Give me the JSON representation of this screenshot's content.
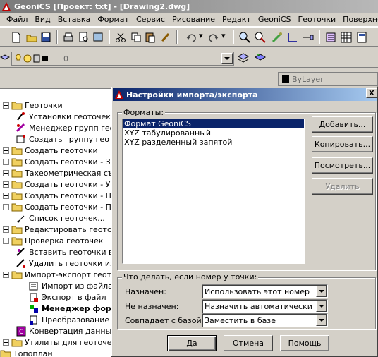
{
  "window": {
    "title": "GeoniCS [Проект: txt] - [Drawing2.dwg]"
  },
  "menubar": {
    "items": [
      "Файл",
      "Вид",
      "Вставка",
      "Формат",
      "Сервис",
      "Рисование",
      "Редакт",
      "GeoniCS",
      "Геоточки",
      "Поверхности"
    ]
  },
  "layer_toolbar": {
    "layer_value": "0",
    "color_value": "ByLayer"
  },
  "tree": {
    "items": [
      "Геоточки",
      "Установки геоточек",
      "Менеджер групп геоточек",
      "Создать группу геоточек",
      "Создать геоточки",
      "Создать геоточки - За",
      "Тахеометрическая съ",
      "Создать геоточки - Ук",
      "Создать геоточки - Пр",
      "Создать геоточки - По",
      "Список геоточек...",
      "Редактировать геоточ",
      "Проверка геоточек",
      "Вставить геоточки в ч",
      "Удалить геоточки из ч",
      "Импорт-экспорт геоточ",
      "Импорт из файла",
      "Экспорт в файл",
      "Менеджер форм",
      "Преобразование",
      "Конвертация данных",
      "Утилиты для геоточек",
      "Топоплан"
    ]
  },
  "dialog": {
    "title": "Настройки импорта/экспорта",
    "close_label": "X",
    "formats_label": "Форматы:",
    "formats": [
      "Формат GeoniCS",
      "XYZ табулированный",
      "XYZ разделенный запятой"
    ],
    "selected_format_index": 0,
    "buttons": {
      "add": "Добавить...",
      "copy": "Копировать...",
      "view": "Посмотреть...",
      "delete": "Удалить"
    },
    "point_number_group": {
      "label": "Что делать, если номер у точки:",
      "assigned_label": "Назначен:",
      "assigned_value": "Использовать этот номер",
      "not_assigned_label": "Не назначен:",
      "not_assigned_value": "Назначить автоматически",
      "match_label": "Совпадает с базой:",
      "match_value": "Заместить в базе"
    },
    "footer": {
      "ok": "Да",
      "cancel": "Отмена",
      "help": "Помощь"
    }
  }
}
